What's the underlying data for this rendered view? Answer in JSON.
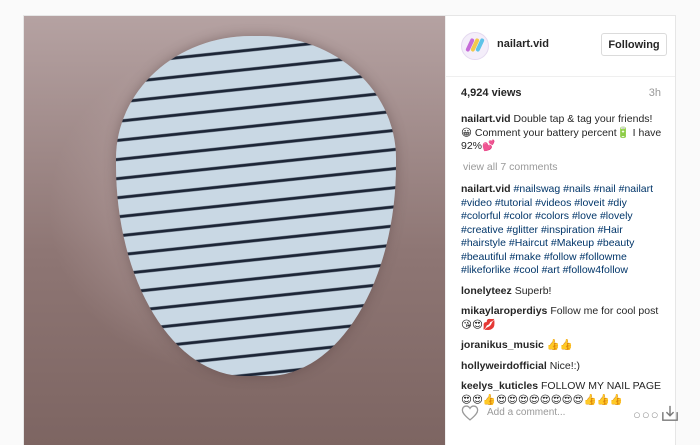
{
  "post": {
    "username": "nailart.vid",
    "follow_label": "Following",
    "views": "4,924 views",
    "time": "3h"
  },
  "caption": {
    "user": "nailart.vid",
    "text": "Double tap & tag your friends!😀 Comment your battery percent🔋 I have 92%💕"
  },
  "view_all": "view all 7 comments",
  "hashtags": {
    "user": "nailart.vid",
    "tags": [
      "#nailswag",
      "#nails",
      "#nail",
      "#nailart",
      "#video",
      "#tutorial",
      "#videos",
      "#loveit",
      "#diy",
      "#colorful",
      "#color",
      "#colors",
      "#love",
      "#lovely",
      "#creative",
      "#glitter",
      "#inspiration",
      "#Hair",
      "#hairstyle",
      "#Haircut",
      "#Makeup",
      "#beauty",
      "#beautiful",
      "#make",
      "#follow",
      "#followme",
      "#likeforlike",
      "#cool",
      "#art",
      "#follow4follow"
    ]
  },
  "comments": [
    {
      "user": "lonelyteez",
      "text": "Superb!"
    },
    {
      "user": "mikaylaroperdiys",
      "text": "Follow me for cool post 😘😍💋"
    },
    {
      "user": "joranikus_music",
      "text": "👍👍"
    },
    {
      "user": "hollyweirdofficial",
      "text": "Nice!:)"
    },
    {
      "user": "keelys_kuticles",
      "text": "FOLLOW MY NAIL PAGE 😍😍👍😍😍😍😍😍😍😍😍👍👍👍"
    }
  ],
  "add_comment_placeholder": "Add a comment...",
  "icons": {
    "like": "heart-icon",
    "more": "more-options-icon",
    "save": "save-icon"
  },
  "colors": {
    "hashtag": "#003569",
    "muted": "#999999",
    "text": "#262626"
  }
}
